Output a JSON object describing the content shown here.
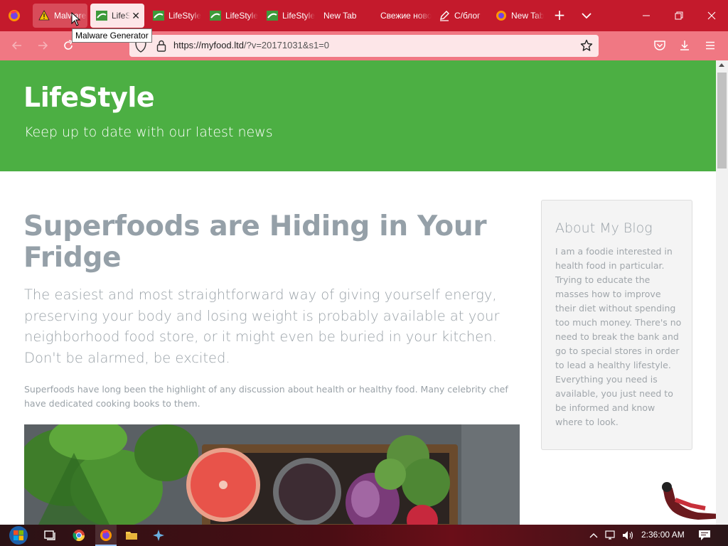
{
  "browser": {
    "tabs": [
      {
        "label": "Malware Generator",
        "icon": "warning-icon",
        "state": "hover"
      },
      {
        "label": "LifeStyle",
        "icon": "lifestyle-favicon",
        "state": "active"
      },
      {
        "label": "LifeStyle",
        "icon": "lifestyle-favicon",
        "state": "normal"
      },
      {
        "label": "LifeStyle",
        "icon": "lifestyle-favicon",
        "state": "normal"
      },
      {
        "label": "LifeStyle",
        "icon": "lifestyle-favicon",
        "state": "normal"
      },
      {
        "label": "New Tab",
        "icon": "",
        "state": "normal"
      },
      {
        "label": "Свежие новости",
        "icon": "",
        "state": "normal"
      },
      {
        "label": "С/блог",
        "icon": "edit-favicon",
        "state": "normal"
      },
      {
        "label": "New Tab",
        "icon": "firefox-icon",
        "state": "normal"
      }
    ],
    "new_tab_symbol": "+",
    "tooltip": "Malware Generator",
    "url": {
      "host": "https://myfood.ltd",
      "path": "/?v=20171031&s1=0"
    }
  },
  "page": {
    "site_title": "LifeStyle",
    "site_tagline": "Keep up to date with our latest news",
    "article": {
      "title": "Superfoods are Hiding in Your Fridge",
      "lead": "The easiest and most straightforward way of giving yourself energy, preserving your body and losing weight is probably available at your neighborhood food store, or it might even be buried in your kitchen. Don't be alarmed, be excited.",
      "body": "Superfoods have long been the highlight of any discussion about health or healthy food. Many celebrity chef have dedicated cooking books to them."
    },
    "sidebar": {
      "heading": "About My Blog",
      "text": "I am a foodie interested in health food in particular. Trying to educate the masses how to improve their diet without spending too much money. There's no need to break the bank and go to special stores in order to lead a healthy lifestyle. Everything you need is available, you just need to be informed and know where to look."
    }
  },
  "taskbar": {
    "clock": "2:36:00 AM"
  },
  "colors": {
    "tabstrip": "#c41a2c",
    "navbar": "#f07883",
    "hero": "#4caf43"
  }
}
